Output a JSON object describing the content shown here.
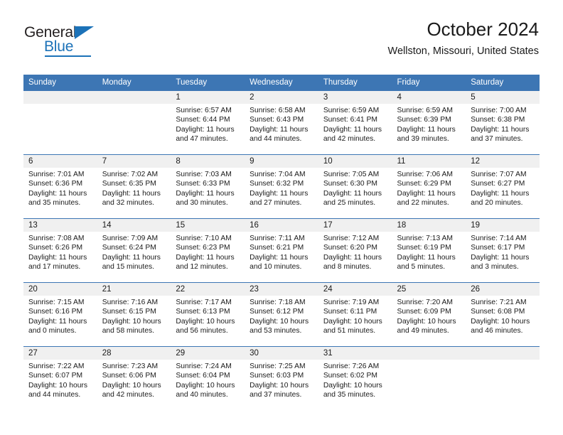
{
  "brand": {
    "name_part1": "General",
    "name_part2": "Blue",
    "logo_icon": "triangle-icon",
    "accent_color": "#1c72b8"
  },
  "header": {
    "title": "October 2024",
    "subtitle": "Wellston, Missouri, United States"
  },
  "calendar": {
    "header_color": "#3d76b4",
    "daynum_band_color": "#f0f0f0",
    "weekday_headers": [
      "Sunday",
      "Monday",
      "Tuesday",
      "Wednesday",
      "Thursday",
      "Friday",
      "Saturday"
    ],
    "weeks": [
      [
        {
          "day": "",
          "sunrise": "",
          "sunset": "",
          "daylight": "",
          "empty": true
        },
        {
          "day": "",
          "sunrise": "",
          "sunset": "",
          "daylight": "",
          "empty": true
        },
        {
          "day": "1",
          "sunrise": "Sunrise: 6:57 AM",
          "sunset": "Sunset: 6:44 PM",
          "daylight": "Daylight: 11 hours and 47 minutes."
        },
        {
          "day": "2",
          "sunrise": "Sunrise: 6:58 AM",
          "sunset": "Sunset: 6:43 PM",
          "daylight": "Daylight: 11 hours and 44 minutes."
        },
        {
          "day": "3",
          "sunrise": "Sunrise: 6:59 AM",
          "sunset": "Sunset: 6:41 PM",
          "daylight": "Daylight: 11 hours and 42 minutes."
        },
        {
          "day": "4",
          "sunrise": "Sunrise: 6:59 AM",
          "sunset": "Sunset: 6:39 PM",
          "daylight": "Daylight: 11 hours and 39 minutes."
        },
        {
          "day": "5",
          "sunrise": "Sunrise: 7:00 AM",
          "sunset": "Sunset: 6:38 PM",
          "daylight": "Daylight: 11 hours and 37 minutes."
        }
      ],
      [
        {
          "day": "6",
          "sunrise": "Sunrise: 7:01 AM",
          "sunset": "Sunset: 6:36 PM",
          "daylight": "Daylight: 11 hours and 35 minutes."
        },
        {
          "day": "7",
          "sunrise": "Sunrise: 7:02 AM",
          "sunset": "Sunset: 6:35 PM",
          "daylight": "Daylight: 11 hours and 32 minutes."
        },
        {
          "day": "8",
          "sunrise": "Sunrise: 7:03 AM",
          "sunset": "Sunset: 6:33 PM",
          "daylight": "Daylight: 11 hours and 30 minutes."
        },
        {
          "day": "9",
          "sunrise": "Sunrise: 7:04 AM",
          "sunset": "Sunset: 6:32 PM",
          "daylight": "Daylight: 11 hours and 27 minutes."
        },
        {
          "day": "10",
          "sunrise": "Sunrise: 7:05 AM",
          "sunset": "Sunset: 6:30 PM",
          "daylight": "Daylight: 11 hours and 25 minutes."
        },
        {
          "day": "11",
          "sunrise": "Sunrise: 7:06 AM",
          "sunset": "Sunset: 6:29 PM",
          "daylight": "Daylight: 11 hours and 22 minutes."
        },
        {
          "day": "12",
          "sunrise": "Sunrise: 7:07 AM",
          "sunset": "Sunset: 6:27 PM",
          "daylight": "Daylight: 11 hours and 20 minutes."
        }
      ],
      [
        {
          "day": "13",
          "sunrise": "Sunrise: 7:08 AM",
          "sunset": "Sunset: 6:26 PM",
          "daylight": "Daylight: 11 hours and 17 minutes."
        },
        {
          "day": "14",
          "sunrise": "Sunrise: 7:09 AM",
          "sunset": "Sunset: 6:24 PM",
          "daylight": "Daylight: 11 hours and 15 minutes."
        },
        {
          "day": "15",
          "sunrise": "Sunrise: 7:10 AM",
          "sunset": "Sunset: 6:23 PM",
          "daylight": "Daylight: 11 hours and 12 minutes."
        },
        {
          "day": "16",
          "sunrise": "Sunrise: 7:11 AM",
          "sunset": "Sunset: 6:21 PM",
          "daylight": "Daylight: 11 hours and 10 minutes."
        },
        {
          "day": "17",
          "sunrise": "Sunrise: 7:12 AM",
          "sunset": "Sunset: 6:20 PM",
          "daylight": "Daylight: 11 hours and 8 minutes."
        },
        {
          "day": "18",
          "sunrise": "Sunrise: 7:13 AM",
          "sunset": "Sunset: 6:19 PM",
          "daylight": "Daylight: 11 hours and 5 minutes."
        },
        {
          "day": "19",
          "sunrise": "Sunrise: 7:14 AM",
          "sunset": "Sunset: 6:17 PM",
          "daylight": "Daylight: 11 hours and 3 minutes."
        }
      ],
      [
        {
          "day": "20",
          "sunrise": "Sunrise: 7:15 AM",
          "sunset": "Sunset: 6:16 PM",
          "daylight": "Daylight: 11 hours and 0 minutes."
        },
        {
          "day": "21",
          "sunrise": "Sunrise: 7:16 AM",
          "sunset": "Sunset: 6:15 PM",
          "daylight": "Daylight: 10 hours and 58 minutes."
        },
        {
          "day": "22",
          "sunrise": "Sunrise: 7:17 AM",
          "sunset": "Sunset: 6:13 PM",
          "daylight": "Daylight: 10 hours and 56 minutes."
        },
        {
          "day": "23",
          "sunrise": "Sunrise: 7:18 AM",
          "sunset": "Sunset: 6:12 PM",
          "daylight": "Daylight: 10 hours and 53 minutes."
        },
        {
          "day": "24",
          "sunrise": "Sunrise: 7:19 AM",
          "sunset": "Sunset: 6:11 PM",
          "daylight": "Daylight: 10 hours and 51 minutes."
        },
        {
          "day": "25",
          "sunrise": "Sunrise: 7:20 AM",
          "sunset": "Sunset: 6:09 PM",
          "daylight": "Daylight: 10 hours and 49 minutes."
        },
        {
          "day": "26",
          "sunrise": "Sunrise: 7:21 AM",
          "sunset": "Sunset: 6:08 PM",
          "daylight": "Daylight: 10 hours and 46 minutes."
        }
      ],
      [
        {
          "day": "27",
          "sunrise": "Sunrise: 7:22 AM",
          "sunset": "Sunset: 6:07 PM",
          "daylight": "Daylight: 10 hours and 44 minutes."
        },
        {
          "day": "28",
          "sunrise": "Sunrise: 7:23 AM",
          "sunset": "Sunset: 6:06 PM",
          "daylight": "Daylight: 10 hours and 42 minutes."
        },
        {
          "day": "29",
          "sunrise": "Sunrise: 7:24 AM",
          "sunset": "Sunset: 6:04 PM",
          "daylight": "Daylight: 10 hours and 40 minutes."
        },
        {
          "day": "30",
          "sunrise": "Sunrise: 7:25 AM",
          "sunset": "Sunset: 6:03 PM",
          "daylight": "Daylight: 10 hours and 37 minutes."
        },
        {
          "day": "31",
          "sunrise": "Sunrise: 7:26 AM",
          "sunset": "Sunset: 6:02 PM",
          "daylight": "Daylight: 10 hours and 35 minutes."
        },
        {
          "day": "",
          "sunrise": "",
          "sunset": "",
          "daylight": "",
          "empty": true
        },
        {
          "day": "",
          "sunrise": "",
          "sunset": "",
          "daylight": "",
          "empty": true
        }
      ]
    ]
  }
}
